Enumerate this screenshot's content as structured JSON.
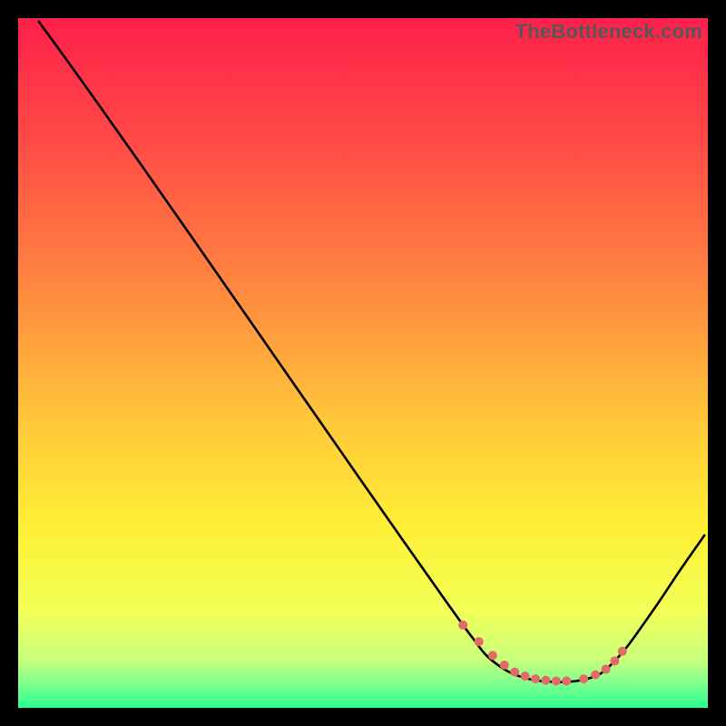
{
  "watermark": "TheBottleneck.com",
  "gradient": {
    "stops": [
      {
        "offset": 0.0,
        "color": "#ff1f4b"
      },
      {
        "offset": 0.18,
        "color": "#ff4b46"
      },
      {
        "offset": 0.38,
        "color": "#ff8440"
      },
      {
        "offset": 0.58,
        "color": "#ffc63a"
      },
      {
        "offset": 0.74,
        "color": "#fff035"
      },
      {
        "offset": 0.86,
        "color": "#f2ff58"
      },
      {
        "offset": 0.93,
        "color": "#c9ff7a"
      },
      {
        "offset": 0.965,
        "color": "#7fff8f"
      },
      {
        "offset": 1.0,
        "color": "#2cff8e"
      }
    ]
  },
  "chart_data": {
    "type": "line",
    "title": "",
    "xlabel": "",
    "ylabel": "",
    "xlim": [
      0,
      100
    ],
    "ylim": [
      0,
      100
    ],
    "series": [
      {
        "name": "curve",
        "x": [
          3,
          7,
          12,
          18,
          25,
          33,
          41,
          49,
          56,
          62,
          64.5,
          66,
          68,
          71,
          74,
          77,
          80,
          82.5,
          84.5,
          86,
          88,
          90,
          93,
          96,
          99.5
        ],
        "y": [
          99.5,
          94,
          87,
          78.5,
          68.5,
          57,
          45.5,
          34,
          24,
          15.5,
          12,
          10,
          7.5,
          5.3,
          4.2,
          3.8,
          3.8,
          4.2,
          5.0,
          6.3,
          8.5,
          11.2,
          15.5,
          20,
          25
        ]
      }
    ],
    "markers": {
      "name": "highlight-points",
      "color": "#e46a6a",
      "radius": 5,
      "x": [
        64.5,
        66.8,
        68.8,
        70.5,
        72,
        73.5,
        75,
        76.5,
        78,
        79.5,
        82,
        83.7,
        85.2,
        86.5,
        87.6
      ],
      "y": [
        12.0,
        9.6,
        7.6,
        6.2,
        5.2,
        4.6,
        4.2,
        4.0,
        3.9,
        3.9,
        4.2,
        4.8,
        5.6,
        6.8,
        8.2
      ]
    }
  }
}
